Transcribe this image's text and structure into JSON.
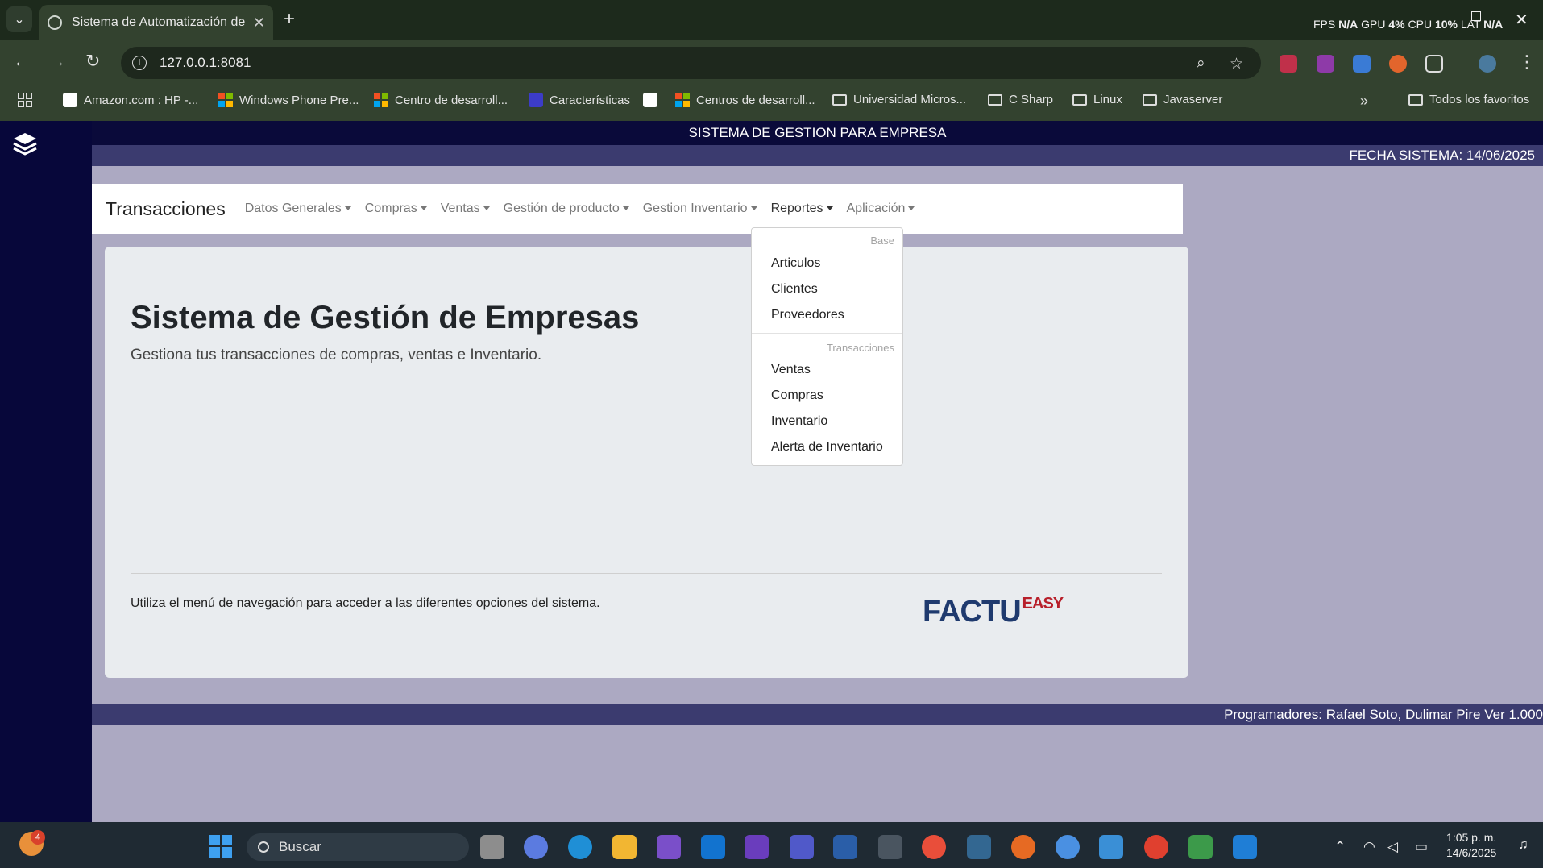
{
  "browser": {
    "tab_title": "Sistema de Automatización de A",
    "address": "127.0.0.1:8081",
    "perf_overlay": {
      "fps_label": "FPS",
      "fps": "N/A",
      "gpu_label": "GPU",
      "gpu": "4%",
      "cpu_label": "CPU",
      "cpu": "10%",
      "lat_label": "LAT",
      "lat": "N/A"
    },
    "bookmarks": [
      "Amazon.com : HP -...",
      "Windows Phone Pre...",
      "Centro de desarroll...",
      "Características",
      "Centros de desarroll...",
      "Universidad Micros...",
      "C Sharp",
      "Linux",
      "Javaserver"
    ],
    "all_bookmarks": "Todos los favoritos"
  },
  "app": {
    "top_title": "SISTEMA DE GESTION PARA EMPRESA",
    "fecha": "FECHA SISTEMA: 14/06/2025",
    "navbar": {
      "brand": "Transacciones",
      "items": [
        "Datos Generales",
        "Compras",
        "Ventas",
        "Gestión de producto",
        "Gestion Inventario",
        "Reportes",
        "Aplicación"
      ]
    },
    "dropdown": {
      "header_base": "Base",
      "base_items": [
        "Articulos",
        "Clientes",
        "Proveedores"
      ],
      "header_trans": "Transacciones",
      "trans_items": [
        "Ventas",
        "Compras",
        "Inventario",
        "Alerta de Inventario"
      ]
    },
    "jumbotron": {
      "title": "Sistema de Gestión de Empresas",
      "lead": "Gestiona tus transacciones de compras, ventas e Inventario.",
      "hint": "Utiliza el menú de navegación para acceder a las diferentes opciones del sistema.",
      "logo_main": "FACTU",
      "logo_accent": "EASY"
    },
    "footer": "Programadores: Rafael Soto, Dulimar Pire Ver 1.000"
  },
  "taskbar": {
    "weather_badge": "4",
    "search_placeholder": "Buscar",
    "time": "1:05 p. m.",
    "date": "14/6/2025"
  },
  "colors": {
    "sidebar": "#07073a",
    "page_bg": "#aca9c2",
    "bar_accent": "#3b3b6f",
    "logo_blue": "#1f3a6e",
    "logo_red": "#b8202b"
  }
}
